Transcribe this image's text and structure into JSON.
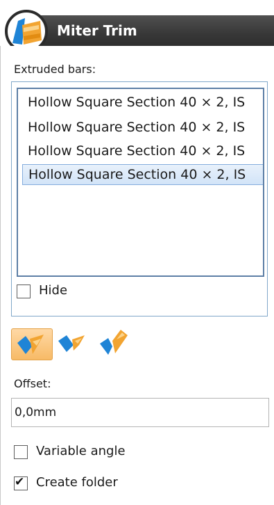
{
  "window": {
    "title": "Miter Trim"
  },
  "bars": {
    "label": "Extruded bars:",
    "items": [
      "Hollow Square Section 40 × 2, IS",
      "Hollow Square Section 40 × 2, IS",
      "Hollow Square Section 40 × 2, IS",
      "Hollow Square Section 40 × 2, IS"
    ],
    "selected_index": 3,
    "hide_label": "Hide",
    "hide_checked": false
  },
  "trim_modes": {
    "icons": [
      "miter-both-icon",
      "miter-left-icon",
      "miter-right-icon"
    ],
    "active_index": 0
  },
  "offset": {
    "label": "Offset:",
    "value": "0,0mm"
  },
  "options": {
    "variable_angle_label": "Variable angle",
    "variable_angle_checked": false,
    "create_folder_label": "Create folder",
    "create_folder_checked": true
  },
  "colors": {
    "title_bar": "#3a3a3a",
    "selection": "#d2e4f8",
    "icon_orange": "#f2a431",
    "icon_blue": "#1f84d6"
  }
}
